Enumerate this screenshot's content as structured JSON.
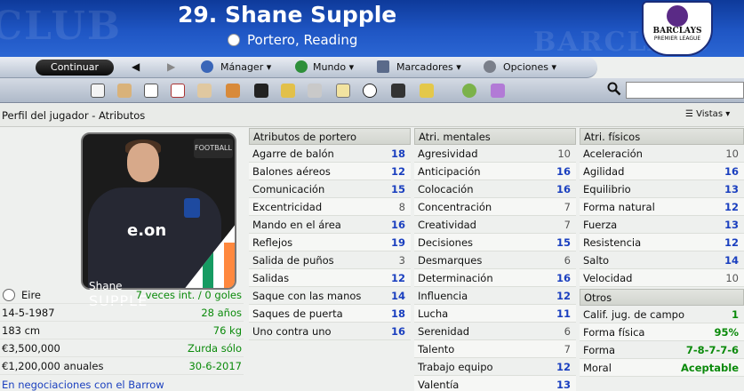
{
  "header": {
    "title": "29. Shane Supple",
    "subtitle": "Portero, Reading",
    "watermark_left": "CLUB",
    "watermark_right": "BARCLAYS",
    "league_logo_text1": "BARCLAYS",
    "league_logo_text2": "PREMIER LEAGUE"
  },
  "nav": {
    "continue_label": "Continuar",
    "back_icon": "back-arrow-icon",
    "forward_icon": "forward-arrow-icon",
    "menus": [
      {
        "label": "Mánager",
        "icon": "manager-icon"
      },
      {
        "label": "Mundo",
        "icon": "globe-icon"
      },
      {
        "label": "Marcadores",
        "icon": "bookmark-icon"
      },
      {
        "label": "Opciones",
        "icon": "options-icon"
      }
    ]
  },
  "toolbar": {
    "icons": [
      "home-icon",
      "bread-icon",
      "book-icon",
      "calendar-icon",
      "people-icon",
      "transfer-icon",
      "film-icon",
      "trophy-icon",
      "search-scout-icon",
      "clipboard-icon",
      "football-icon",
      "binoculars-icon",
      "cards-icon",
      "help-icon",
      "question-icon"
    ],
    "search_placeholder": ""
  },
  "breadcrumb": {
    "text": "Perfil del jugador - Atributos",
    "views_label": "Vistas"
  },
  "player": {
    "first_name": "Shane",
    "last_name": "SUPPLE",
    "photo_badge": "FOOTBALL",
    "shirt_sponsor": "e.on"
  },
  "info": [
    {
      "label": "Eire",
      "value": "7 veces int. / 0 goles"
    },
    {
      "label": "14-5-1987",
      "value": "28 años"
    },
    {
      "label": "183 cm",
      "value": "76 kg"
    },
    {
      "label": "€3,500,000",
      "value": "Zurda sólo"
    },
    {
      "label": "€1,200,000 anuales",
      "value": "30-6-2017"
    }
  ],
  "info_link": "En negociaciones con el Barrow",
  "columns": {
    "goalkeeper": {
      "title": "Atributos de portero",
      "rows": [
        {
          "name": "Agarre de balón",
          "value": "18",
          "tone": "blue"
        },
        {
          "name": "Balones aéreos",
          "value": "12",
          "tone": "blue"
        },
        {
          "name": "Comunicación",
          "value": "15",
          "tone": "blue"
        },
        {
          "name": "Excentricidad",
          "value": "8",
          "tone": "grey"
        },
        {
          "name": "Mando en el área",
          "value": "16",
          "tone": "blue"
        },
        {
          "name": "Reflejos",
          "value": "19",
          "tone": "blue"
        },
        {
          "name": "Salida de puños",
          "value": "3",
          "tone": "grey"
        },
        {
          "name": "Salidas",
          "value": "12",
          "tone": "blue"
        },
        {
          "name": "Saque con las manos",
          "value": "14",
          "tone": "blue"
        },
        {
          "name": "Saques de puerta",
          "value": "18",
          "tone": "blue"
        },
        {
          "name": "Uno contra uno",
          "value": "16",
          "tone": "blue"
        }
      ]
    },
    "mental": {
      "title": "Atri. mentales",
      "rows": [
        {
          "name": "Agresividad",
          "value": "10",
          "tone": "grey"
        },
        {
          "name": "Anticipación",
          "value": "16",
          "tone": "blue"
        },
        {
          "name": "Colocación",
          "value": "16",
          "tone": "blue"
        },
        {
          "name": "Concentración",
          "value": "7",
          "tone": "grey"
        },
        {
          "name": "Creatividad",
          "value": "7",
          "tone": "grey"
        },
        {
          "name": "Decisiones",
          "value": "15",
          "tone": "blue"
        },
        {
          "name": "Desmarques",
          "value": "6",
          "tone": "grey"
        },
        {
          "name": "Determinación",
          "value": "16",
          "tone": "blue"
        },
        {
          "name": "Influencia",
          "value": "12",
          "tone": "blue"
        },
        {
          "name": "Lucha",
          "value": "11",
          "tone": "blue"
        },
        {
          "name": "Serenidad",
          "value": "6",
          "tone": "grey"
        },
        {
          "name": "Talento",
          "value": "7",
          "tone": "grey"
        },
        {
          "name": "Trabajo equipo",
          "value": "12",
          "tone": "blue"
        },
        {
          "name": "Valentía",
          "value": "13",
          "tone": "blue"
        }
      ]
    },
    "physical": {
      "title": "Atri. físicos",
      "rows": [
        {
          "name": "Aceleración",
          "value": "10",
          "tone": "grey"
        },
        {
          "name": "Agilidad",
          "value": "16",
          "tone": "blue"
        },
        {
          "name": "Equilibrio",
          "value": "13",
          "tone": "blue"
        },
        {
          "name": "Forma natural",
          "value": "12",
          "tone": "blue"
        },
        {
          "name": "Fuerza",
          "value": "13",
          "tone": "blue"
        },
        {
          "name": "Resistencia",
          "value": "12",
          "tone": "blue"
        },
        {
          "name": "Salto",
          "value": "14",
          "tone": "blue"
        },
        {
          "name": "Velocidad",
          "value": "10",
          "tone": "grey"
        }
      ]
    },
    "other": {
      "title": "Otros",
      "rows": [
        {
          "name": "Calif. jug. de campo",
          "value": "1",
          "tone": "green"
        },
        {
          "name": "Forma física",
          "value": "95%",
          "tone": "green"
        },
        {
          "name": "Forma",
          "value": "7-8-7-7-6",
          "tone": "green"
        },
        {
          "name": "Moral",
          "value": "Aceptable",
          "tone": "green"
        }
      ]
    }
  },
  "colors": {
    "header_blue": "#1f56c4",
    "attr_blue": "#1a3fbf",
    "good_green": "#0a8a0a"
  }
}
